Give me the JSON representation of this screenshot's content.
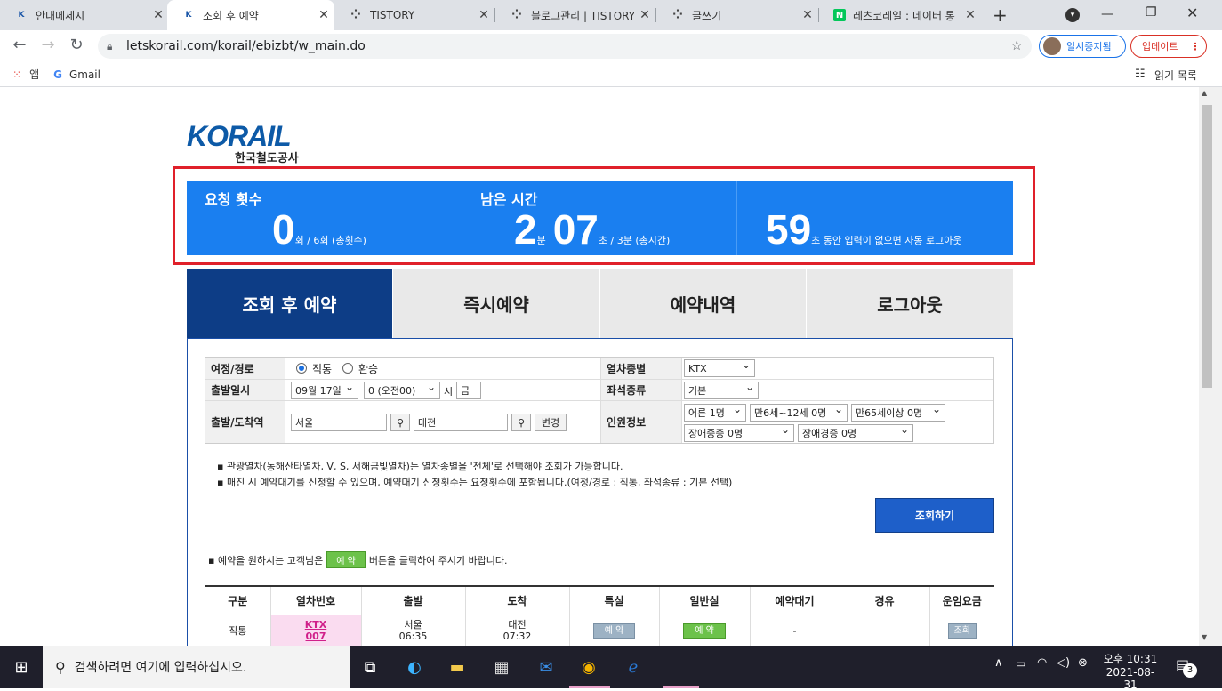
{
  "browser": {
    "tabs": [
      {
        "label": "안내메세지",
        "favicon": "korail-icon"
      },
      {
        "label": "조회 후 예약",
        "favicon": "korail-icon",
        "active": true
      },
      {
        "label": "TISTORY",
        "favicon": "tistory-icon"
      },
      {
        "label": "블로그관리 | TISTORY",
        "favicon": "tistory-icon"
      },
      {
        "label": "글쓰기",
        "favicon": "tistory-icon"
      },
      {
        "label": "레츠코레일 : 네이버 통",
        "favicon": "naver-icon"
      }
    ],
    "url": "letskorail.com/korail/ebizbt/w_main.do",
    "profile_label": "일시중지됨",
    "update_label": "업데이트",
    "bookmarks": {
      "apps": "앱",
      "gmail": "Gmail",
      "reading_list": "읽기 목록"
    }
  },
  "logo": {
    "brand": "KORAIL",
    "subtitle": "한국철도공사"
  },
  "status": {
    "requests": {
      "label": "요청 횟수",
      "count": "0",
      "detail": "회 / 6회 (총횟수)"
    },
    "time": {
      "label": "남은 시간",
      "minutes": "2",
      "minutes_unit": "분",
      "seconds": "07",
      "detail": "초 / 3분 (총시간)"
    },
    "idle": {
      "seconds": "59",
      "detail": "초 동안 입력이 없으면 자동 로그아웃"
    }
  },
  "menu_tabs": [
    "조회 후 예약",
    "즉시예약",
    "예약내역",
    "로그아웃"
  ],
  "form": {
    "route_label": "여정/경로",
    "route_direct": "직통",
    "route_transfer": "환승",
    "date_label": "출발일시",
    "date_value": "09월 17일",
    "time_value": "0 (오전00)",
    "hour_suffix": "시",
    "weekday": "금",
    "station_label": "출발/도착역",
    "from_station": "서울",
    "to_station": "대전",
    "swap_button": "변경",
    "train_type_label": "열차종별",
    "train_type_value": "KTX",
    "seat_type_label": "좌석종류",
    "seat_type_value": "기본",
    "passengers_label": "인원정보",
    "adult": "어른 1명",
    "child": "만6세~12세 0명",
    "senior": "만65세이상 0명",
    "disabled_severe": "장애중증 0명",
    "disabled_mild": "장애경증 0명"
  },
  "notes": [
    "▪ 관광열차(동해산타열차, V, S, 서해금빛열차)는 열차종별을 '전체'로 선택해야 조회가 가능합니다.",
    "▪ 매진 시 예약대기를 신청할 수 있으며, 예약대기 신청횟수는 요청횟수에 포함됩니다.(여정/경로 : 직통, 좌석종류 : 기본 선택)"
  ],
  "search_button": "조회하기",
  "reserve_note": {
    "prefix": "▪ 예약을 원하시는 고객님은",
    "button": "예 약",
    "suffix": "버튼을 클릭하여 주시기 바랍니다."
  },
  "results": {
    "headers": [
      "구분",
      "열차번호",
      "출발",
      "도착",
      "특실",
      "일반실",
      "예약대기",
      "경유",
      "운임요금"
    ],
    "rows": [
      {
        "type": "직통",
        "train_kind": "KTX",
        "train_no": "007",
        "dep_station": "서울",
        "dep_time": "06:35",
        "arr_station": "대전",
        "arr_time": "07:32",
        "special": "예 약",
        "general": "예 약",
        "waitlist": "-",
        "via": "",
        "fare": "조회"
      }
    ]
  },
  "taskbar": {
    "search_placeholder": "검색하려면 여기에 입력하십시오.",
    "time": "오후 10:31",
    "date": "2021-08-31",
    "notifications": "3"
  },
  "colors": {
    "status_blue": "#1a7ff0",
    "active_tab": "#0d3d86",
    "highlight_red": "#e0202a",
    "search_button": "#1e5fc9"
  }
}
